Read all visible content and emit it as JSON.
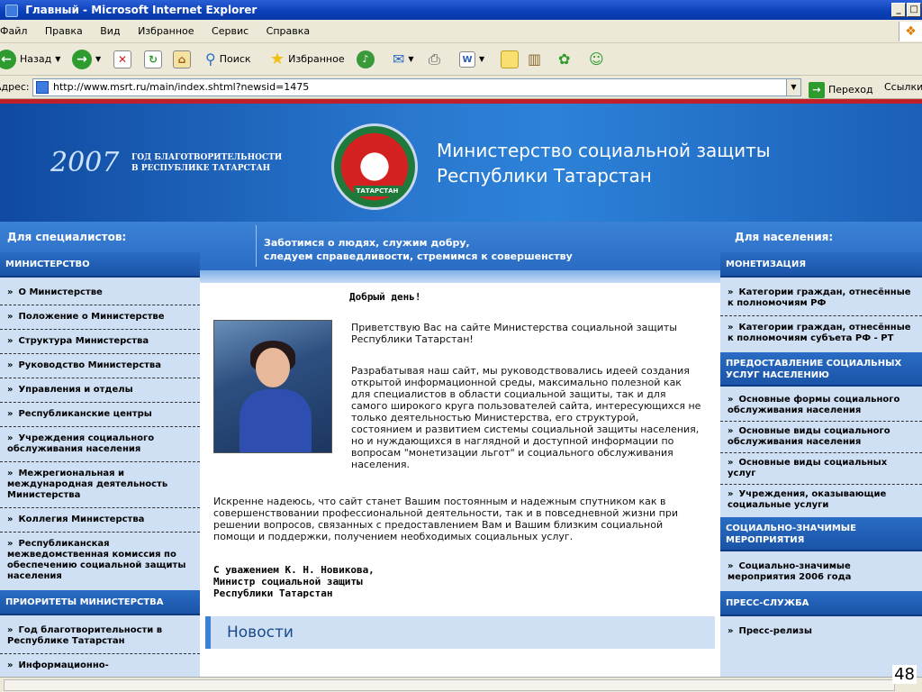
{
  "window": {
    "title": "Главный - Microsoft Internet Explorer",
    "min": "_",
    "max": "□"
  },
  "menu": [
    "Файл",
    "Правка",
    "Вид",
    "Избранное",
    "Сервис",
    "Справка"
  ],
  "toolbar": {
    "back": "Назад",
    "search": "Поиск",
    "favorites": "Избранное"
  },
  "address": {
    "label": "Адрес:",
    "url": "http://www.msrt.ru/main/index.shtml?newsid=1475",
    "go": "Переход",
    "links": "Ссылки"
  },
  "banner": {
    "year": "2007",
    "charity": "ГОД БЛАГОТВОРИТЕЛЬНОСТИ В РЕСПУБЛИКЕ ТАТАРСТАН",
    "emblem_ribbon": "ТАТАРСТАН",
    "ministry_line1": "Министерство социальной защиты",
    "ministry_line2": "Республики Татарстан"
  },
  "strip": {
    "left": "Для специалистов:",
    "right": "Для населения:",
    "slogan_line1": "Заботимся о людях, служим добру,",
    "slogan_line2": "следуем справедливости, стремимся к совершенству"
  },
  "left": {
    "section1": "МИНИСТЕРСТВО",
    "items1": [
      "О Министерстве",
      "Положение о Министерстве",
      "Структура Министерства",
      "Руководство Министерства",
      "Управления и отделы",
      "Республиканские центры",
      "Учреждения социального обслуживания населения",
      "Межрегиональная и международная деятельность Министерства",
      "Коллегия Министерства",
      "Республиканская межведомственная комиссия по обеспечению социальной защиты населения"
    ],
    "section2": "ПРИОРИТЕТЫ МИНИСТЕРСТВА",
    "items2": [
      "Год благотворительности в Республике Татарстан",
      "Информационно-"
    ]
  },
  "right": {
    "section1": "МОНЕТИЗАЦИЯ",
    "items1": [
      "Категории граждан, отнесённые к полномочиям РФ",
      "Категории граждан, отнесённые к полномочиям субъета РФ - РТ"
    ],
    "section2": "ПРЕДОСТАВЛЕНИЕ СОЦИАЛЬНЫХ УСЛУГ НАСЕЛЕНИЮ",
    "items2": [
      "Основные формы социального обслуживания населения",
      "Основные виды социального обслуживания населения",
      "Основные виды социальных услуг",
      "Учреждения, оказывающие социальные услуги"
    ],
    "section3": "СОЦИАЛЬНО-ЗНАЧИМЫЕ МЕРОПРИЯТИЯ",
    "items3": [
      "Социально-значимые мероприятия 2006 года"
    ],
    "section4": "ПРЕСС-СЛУЖБА",
    "items4": [
      "Пресс-релизы"
    ]
  },
  "main": {
    "greeting": "Добрый день!",
    "p1": "Приветствую Вас на сайте Министерства социальной защиты Республики Татарстан!",
    "p2": "Разрабатывая наш сайт, мы руководствовались идеей создания открытой информационной среды, максимально полезной как для специалистов в области социальной защиты, так и для самого широкого круга пользователей сайта, интересующихся не только деятельностью Министерства, его структурой, состоянием и развитием системы социальной защиты населения, но и нуждающихся в наглядной и доступной информации по вопросам \"монетизации льгот\" и социального обслуживания населения.",
    "p3": "Искренне надеюсь, что сайт станет Вашим постоянным и надежным спутником как в совершенствовании профессиональной деятельности, так и в повседневной жизни при решении вопросов, связанных с предоставлением Вам и Вашим близким социальной помощи и поддержки, получением необходимых социальных услуг.",
    "sign1": "С уважением К. Н. Новикова,",
    "sign2": "Министр социальной защиты",
    "sign3": "Республики Татарстан",
    "news": "Новости"
  },
  "slide_number": "48"
}
